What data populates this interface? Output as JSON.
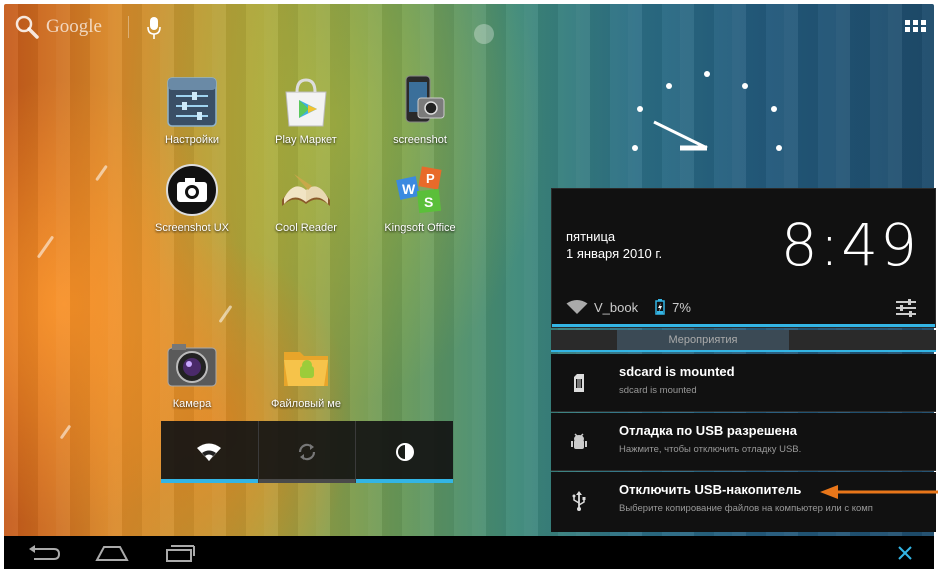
{
  "top_bar": {
    "search_label": "Google",
    "search_icon": "search-icon",
    "mic_icon": "mic-icon",
    "apps_icon": "all-apps-icon"
  },
  "home_apps": [
    {
      "label": "Настройки",
      "icon": "settings-app-icon"
    },
    {
      "label": "Play Маркет",
      "icon": "play-store-icon"
    },
    {
      "label": "screenshot",
      "icon": "screenshot-app-icon"
    },
    {
      "label": "Screenshot UX",
      "icon": "camera-screenshot-icon"
    },
    {
      "label": "Cool Reader",
      "icon": "book-icon"
    },
    {
      "label": "Kingsoft Office",
      "icon": "office-icon"
    },
    {
      "label": "Камера",
      "icon": "camera-icon"
    },
    {
      "label": "Файловый ме",
      "icon": "file-manager-icon"
    }
  ],
  "quick_settings": [
    {
      "name": "wifi",
      "icon": "wifi-icon",
      "active": true
    },
    {
      "name": "sync",
      "icon": "sync-icon",
      "active": false
    },
    {
      "name": "brightness",
      "icon": "brightness-icon",
      "active": true
    }
  ],
  "status": {
    "day": "пятница",
    "date": "1 января 2010 г.",
    "time": "8:49",
    "network": "V_book",
    "battery": "7%"
  },
  "tab_label": "Мероприятия",
  "notifications": [
    {
      "title": "sdcard is mounted",
      "text": "sdcard is mounted",
      "icon": "sdcard-icon"
    },
    {
      "title": "Отладка по USB разрешена",
      "text": "Нажмите, чтобы отключить отладку USB.",
      "icon": "android-debug-icon"
    },
    {
      "title": "Отключить USB-накопитель",
      "text": "Выберите копирование файлов на компьютер или с комп",
      "icon": "usb-icon"
    }
  ],
  "colors": {
    "accent": "#33b5e5",
    "arrow": "#e8761a",
    "panel_bg": "#111111"
  },
  "nav": {
    "back_icon": "back-icon",
    "home_icon": "home-icon",
    "recents_icon": "recents-icon",
    "close_icon": "close-icon"
  }
}
